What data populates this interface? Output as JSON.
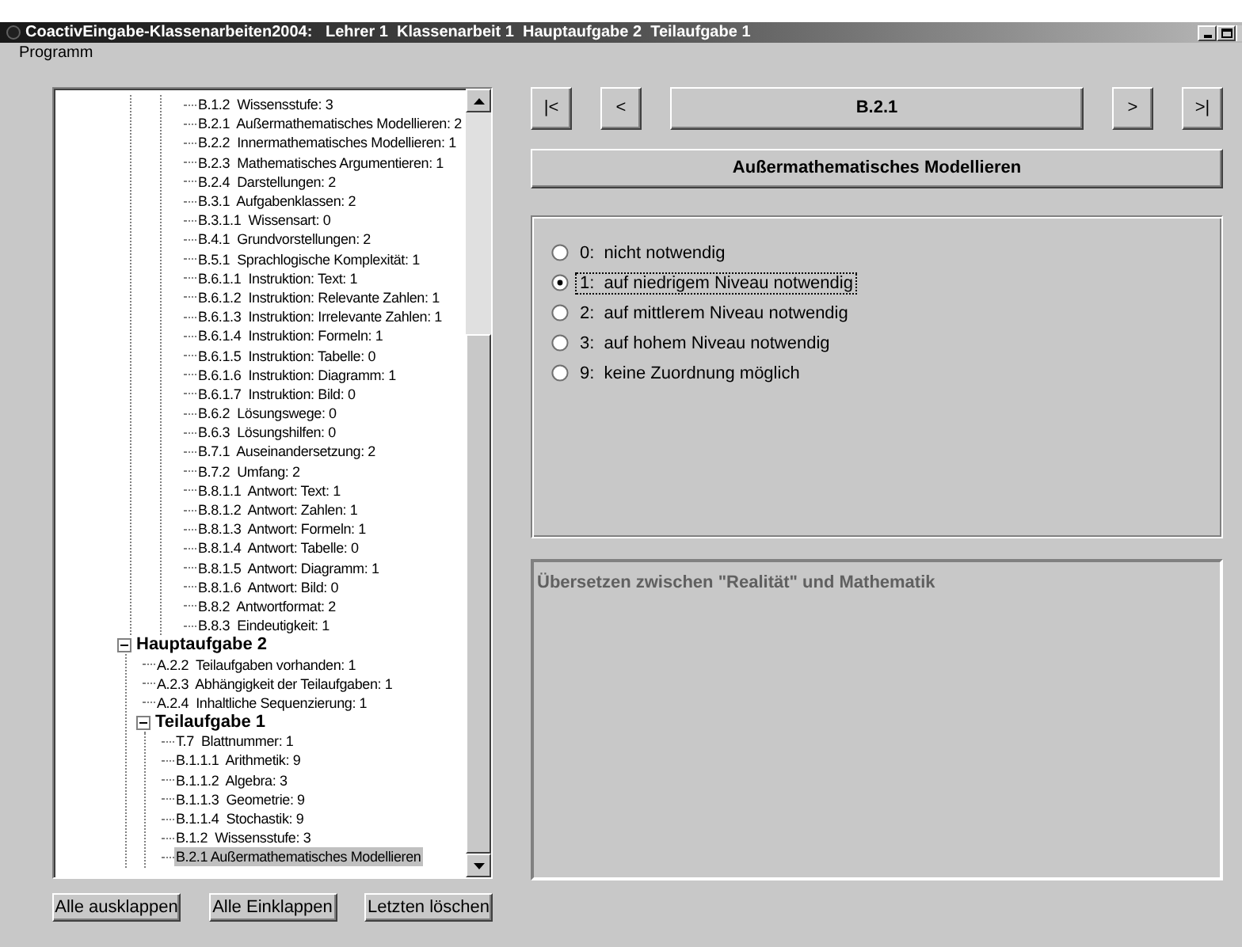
{
  "window": {
    "title": "CoactivEingabe-Klassenarbeiten2004:   Lehrer 1  Klassenarbeit 1  Hauptaufgabe 2  Teilaufgabe 1"
  },
  "menu": [
    "Programm"
  ],
  "tree": {
    "items": [
      {
        "children": [
          {
            "children": [
              {
                "label": "B.1.2  Wissensstufe: 3",
                "selected": false
              },
              {
                "label": "B.2.1  Außermathematisches Modellieren: 2",
                "selected": false
              },
              {
                "label": "B.2.2  Innermathematisches Modellieren: 1",
                "selected": false
              },
              {
                "label": "B.2.3  Mathematisches Argumentieren: 1",
                "selected": false
              },
              {
                "label": "B.2.4  Darstellungen: 2",
                "selected": false
              },
              {
                "label": "B.3.1  Aufgabenklassen: 2",
                "selected": false
              },
              {
                "label": "B.3.1.1  Wissensart: 0",
                "selected": false
              },
              {
                "label": "B.4.1  Grundvorstellungen: 2",
                "selected": false
              },
              {
                "label": "B.5.1  Sprachlogische Komplexität: 1",
                "selected": false
              },
              {
                "label": "B.6.1.1  Instruktion: Text: 1",
                "selected": false
              },
              {
                "label": "B.6.1.2  Instruktion: Relevante Zahlen: 1",
                "selected": false
              },
              {
                "label": "B.6.1.3  Instruktion: Irrelevante Zahlen: 1",
                "selected": false
              },
              {
                "label": "B.6.1.4  Instruktion: Formeln: 1",
                "selected": false
              },
              {
                "label": "B.6.1.5  Instruktion: Tabelle: 0",
                "selected": false
              },
              {
                "label": "B.6.1.6  Instruktion: Diagramm: 1",
                "selected": false
              },
              {
                "label": "B.6.1.7  Instruktion: Bild: 0",
                "selected": false
              },
              {
                "label": "B.6.2  Lösungswege: 0",
                "selected": false
              },
              {
                "label": "B.6.3  Lösungshilfen: 0",
                "selected": false
              },
              {
                "label": "B.7.1  Auseinandersetzung: 2",
                "selected": false
              },
              {
                "label": "B.7.2  Umfang: 2",
                "selected": false
              },
              {
                "label": "B.8.1.1  Antwort: Text: 1",
                "selected": false
              },
              {
                "label": "B.8.1.2  Antwort: Zahlen: 1",
                "selected": false
              },
              {
                "label": "B.8.1.3  Antwort: Formeln: 1",
                "selected": false
              },
              {
                "label": "B.8.1.4  Antwort: Tabelle: 0",
                "selected": false
              },
              {
                "label": "B.8.1.5  Antwort: Diagramm: 1",
                "selected": false
              },
              {
                "label": "B.8.1.6  Antwort: Bild: 0",
                "selected": false
              },
              {
                "label": "B.8.2  Antwortformat: 2",
                "selected": false
              },
              {
                "label": "B.8.3  Eindeutigkeit: 1",
                "selected": false
              }
            ]
          }
        ]
      },
      {
        "label": "Hauptaufgabe 2",
        "selected": false,
        "expanded": true,
        "children": [
          {
            "label": "A.2.2  Teilaufgaben vorhanden: 1",
            "selected": false
          },
          {
            "label": "A.2.3  Abhängigkeit der Teilaufgaben: 1",
            "selected": false
          },
          {
            "label": "A.2.4  Inhaltliche Sequenzierung: 1",
            "selected": false
          },
          {
            "label": "Teilaufgabe 1",
            "selected": false,
            "expanded": true,
            "children": [
              {
                "label": "T.7  Blattnummer: 1",
                "selected": false
              },
              {
                "label": "B.1.1.1  Arithmetik: 9",
                "selected": false
              },
              {
                "label": "B.1.1.2  Algebra: 3",
                "selected": false
              },
              {
                "label": "B.1.1.3  Geometrie: 9",
                "selected": false
              },
              {
                "label": "B.1.1.4  Stochastik: 9",
                "selected": false
              },
              {
                "label": "B.1.2  Wissensstufe: 3",
                "selected": false
              },
              {
                "label": "B.2.1 Außermathematisches Modellieren",
                "selected": true
              }
            ]
          }
        ]
      }
    ]
  },
  "tree_buttons": [
    "Alle ausklappen",
    "Alle Einklappen",
    "Letzten löschen"
  ],
  "navigation": {
    "first": "|<",
    "previous": "<",
    "current": "B.2.1",
    "next": ">",
    "last": ">|"
  },
  "category_title": "Außermathematisches Modellieren",
  "options": [
    {
      "label": "0:  nicht notwendig",
      "selected": false
    },
    {
      "label": "1:  auf niedrigem Niveau notwendig",
      "selected": true
    },
    {
      "label": "2:  auf mittlerem Niveau notwendig",
      "selected": false
    },
    {
      "label": "3:  auf hohem Niveau notwendig",
      "selected": false
    },
    {
      "label": "9:  keine Zuordnung möglich",
      "selected": false
    }
  ],
  "description": "Übersetzen zwischen \"Realität\" und Mathematik"
}
